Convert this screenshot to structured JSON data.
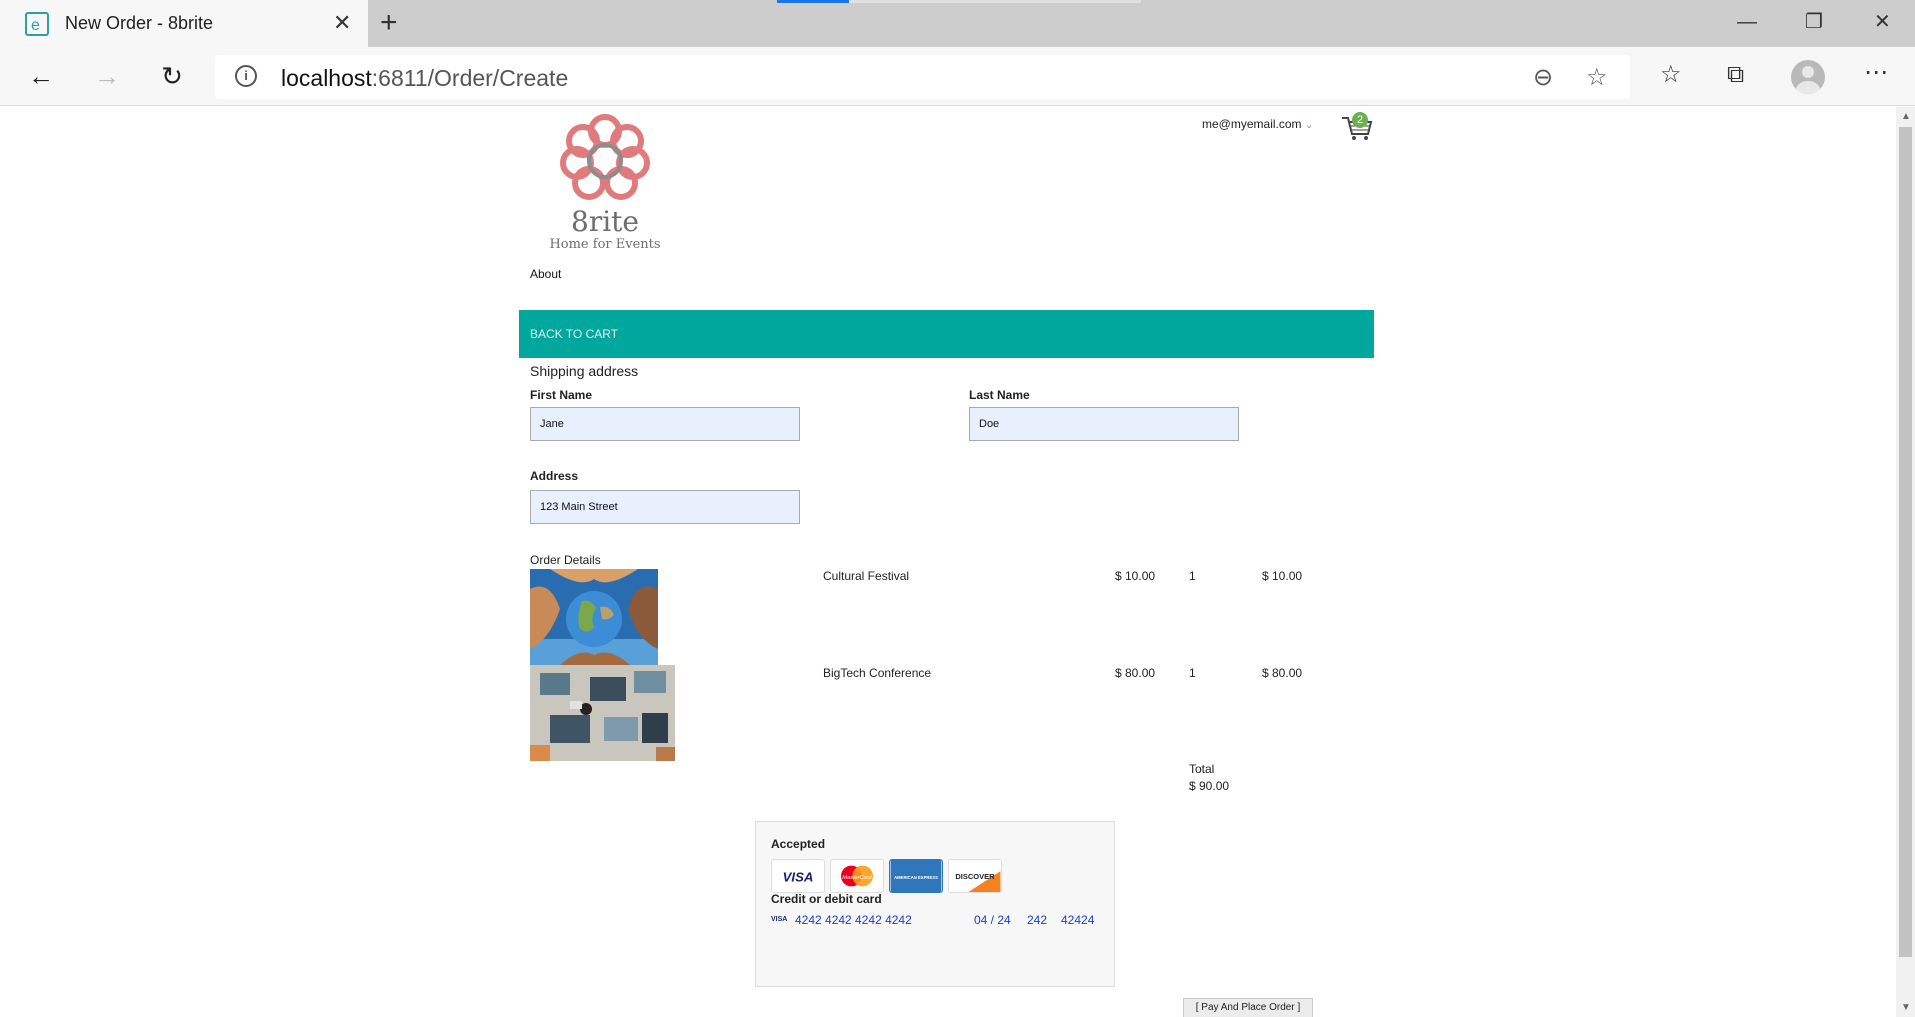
{
  "browser": {
    "tab_title": "New Order - 8brite",
    "url_host": "localhost",
    "url_path": ":6811/Order/Create"
  },
  "header": {
    "logo_name": "8rite",
    "logo_tagline": "Home for Events",
    "user_email": "me@myemail.com",
    "cart_count": "2",
    "nav_about": "About"
  },
  "toolbar": {
    "back_to_cart": "Back to Cart"
  },
  "shipping": {
    "title": "Shipping address",
    "first_name_label": "First Name",
    "first_name_value": "Jane",
    "last_name_label": "Last Name",
    "last_name_value": "Doe",
    "address_label": "Address",
    "address_value": "123 Main Street"
  },
  "order": {
    "title": "Order Details",
    "items": [
      {
        "name": "Cultural Festival",
        "price": "$ 10.00",
        "quantity": "1",
        "subtotal": "$ 10.00"
      },
      {
        "name": "BigTech Conference",
        "price": "$ 80.00",
        "quantity": "1",
        "subtotal": "$ 80.00"
      }
    ],
    "total_label": "Total",
    "total_value": "$ 90.00"
  },
  "payment": {
    "accepted_label": "Accepted",
    "card_brands": [
      "VISA",
      "MasterCard",
      "AMERICAN EXPRESS",
      "DISCOVER"
    ],
    "card_label": "Credit or debit card",
    "card_brand_mini": "VISA",
    "card_number": "4242 4242 4242 4242",
    "card_expiry": "04 / 24",
    "card_cvc": "242",
    "card_zip": "42424",
    "place_order": "[ Pay And Place Order ]"
  },
  "colors": {
    "accent_teal": "#00a79d",
    "input_fill": "#e8f0fe",
    "card_text": "#1a3cd4"
  }
}
